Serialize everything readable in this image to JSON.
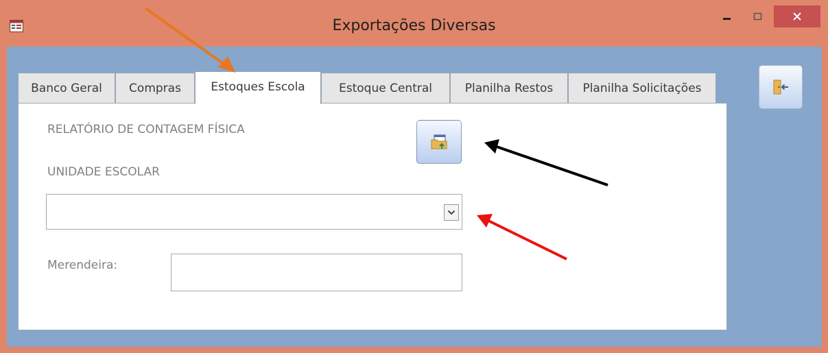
{
  "window": {
    "title": "Exportações Diversas",
    "frame_color": "#e0866a",
    "client_color": "#86a6cc"
  },
  "tabs": [
    {
      "label": "Banco Geral",
      "active": false
    },
    {
      "label": "Compras",
      "active": false
    },
    {
      "label": "Estoques Escola",
      "active": true
    },
    {
      "label": "Estoque Central",
      "active": false
    },
    {
      "label": "Planilha Restos",
      "active": false
    },
    {
      "label": "Planilha Solicitações",
      "active": false
    }
  ],
  "panel": {
    "report_title": "RELATÓRIO DE CONTAGEM FÍSICA",
    "unit_label": "UNIDADE ESCOLAR",
    "unit_value": "",
    "merendeira_label": "Merendeira:",
    "merendeira_value": ""
  },
  "icons": {
    "app": "form-icon",
    "export": "export-table-icon",
    "exit": "exit-door-icon",
    "dropdown": "chevron-down-icon"
  },
  "annotations": {
    "arrow_colors": [
      "#e87722",
      "#000000",
      "#ee1111"
    ]
  }
}
